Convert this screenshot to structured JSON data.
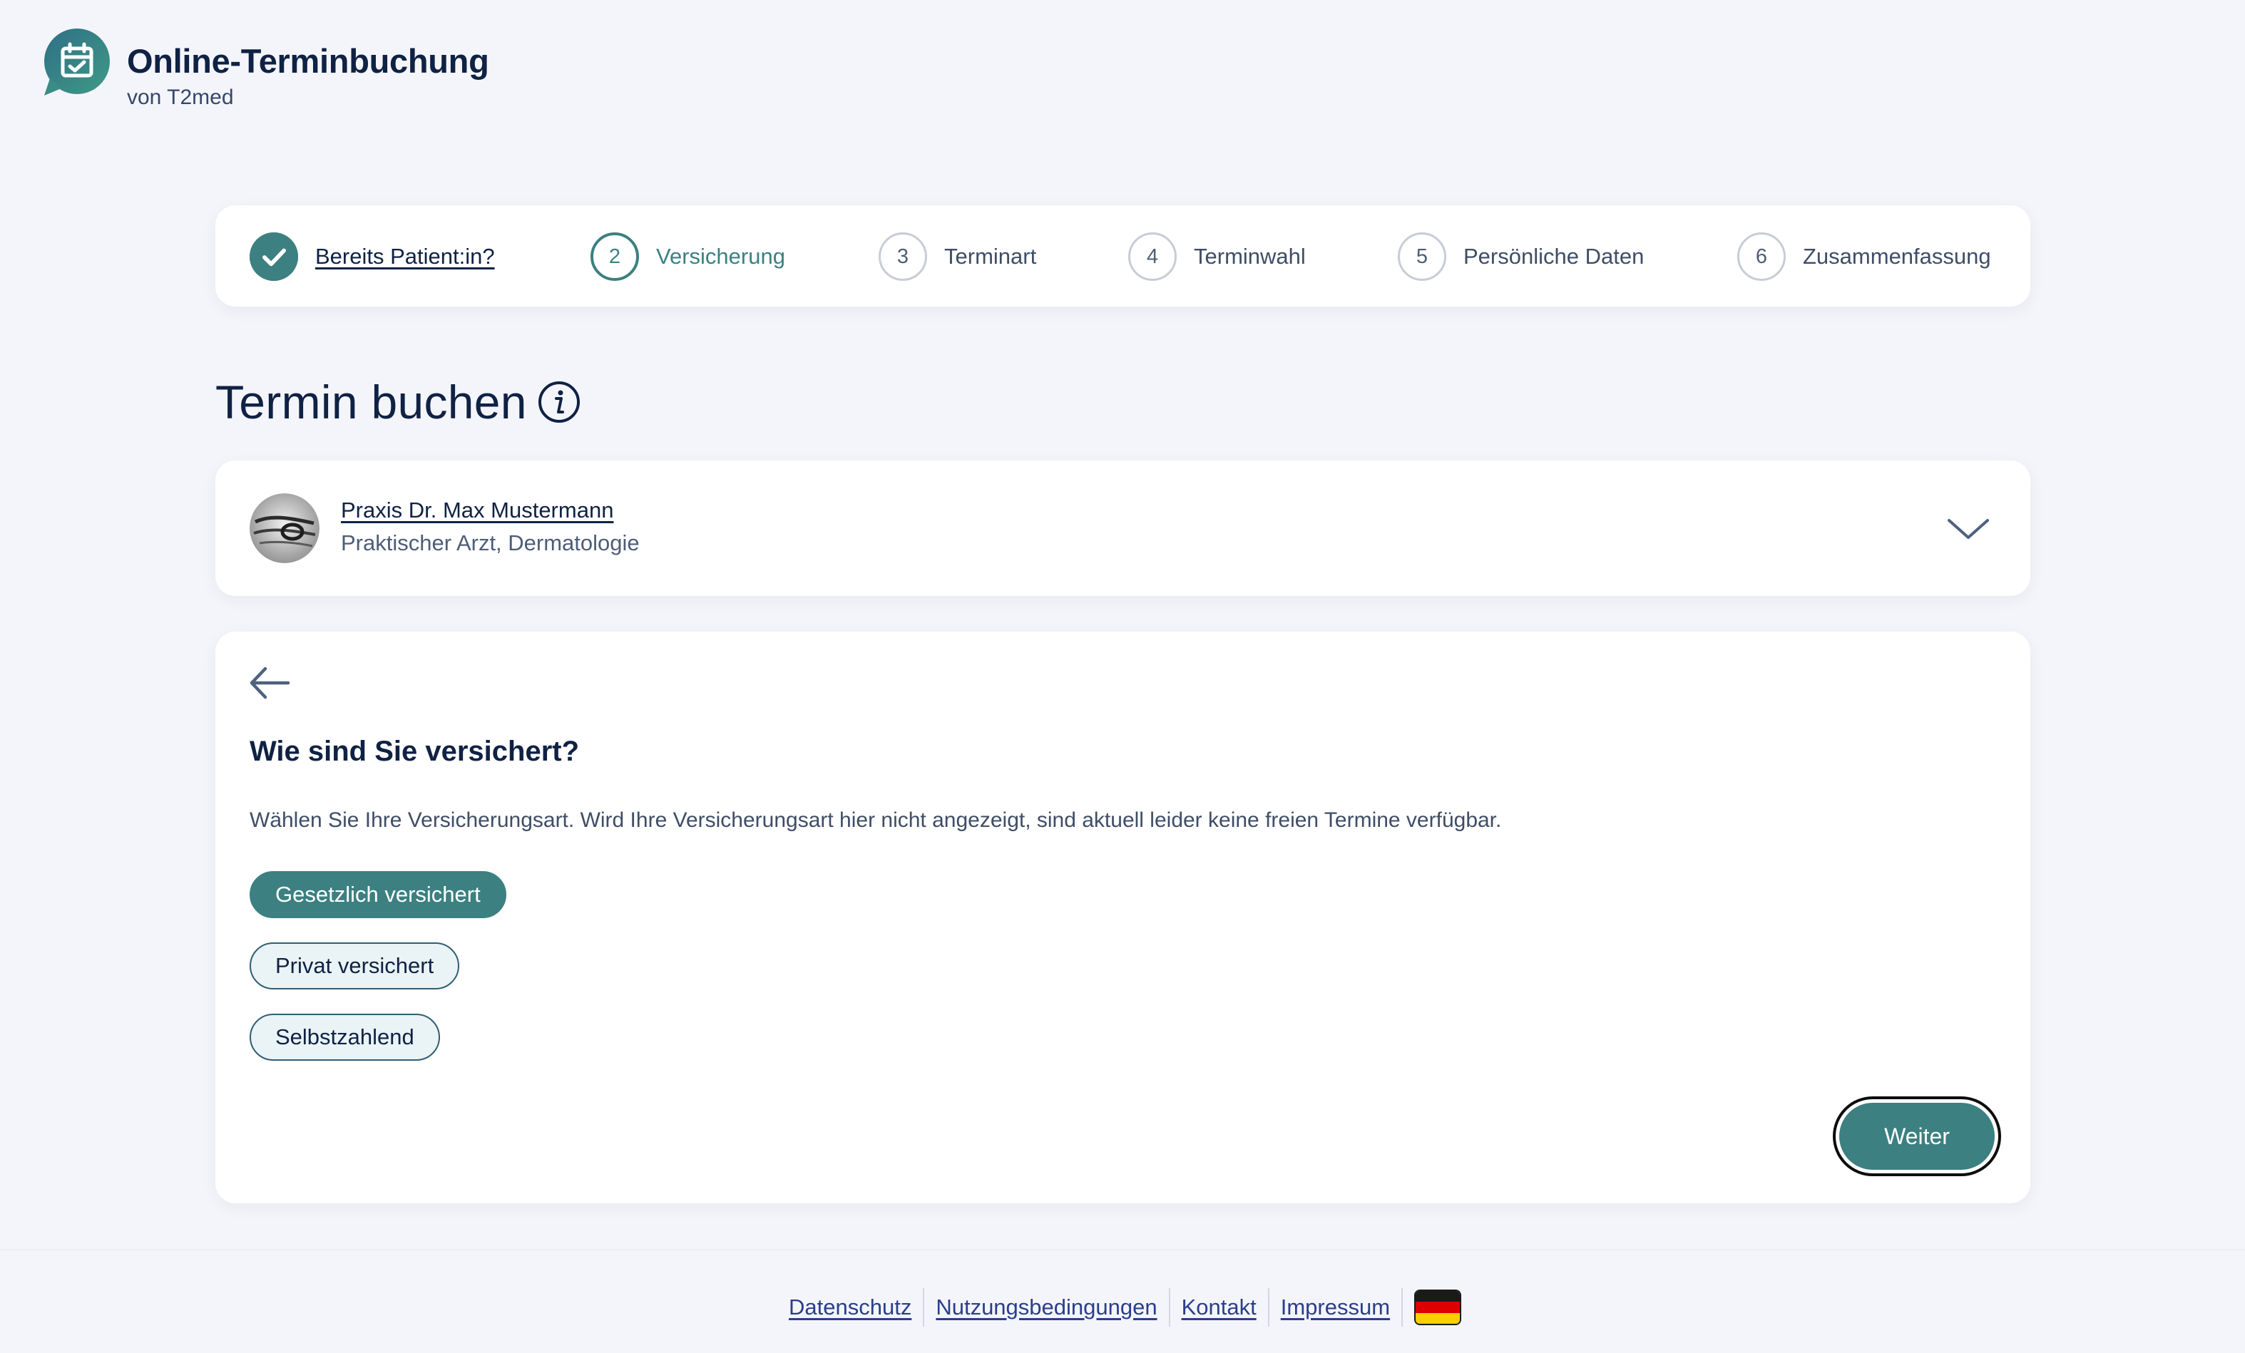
{
  "brand": {
    "title": "Online-Terminbuchung",
    "subtitle": "von T2med"
  },
  "stepper": {
    "steps": [
      {
        "number": "",
        "label": "Bereits Patient:in?",
        "state": "done"
      },
      {
        "number": "2",
        "label": "Versicherung",
        "state": "active"
      },
      {
        "number": "3",
        "label": "Terminart",
        "state": "upcoming"
      },
      {
        "number": "4",
        "label": "Terminwahl",
        "state": "upcoming"
      },
      {
        "number": "5",
        "label": "Persönliche Daten",
        "state": "upcoming"
      },
      {
        "number": "6",
        "label": "Zusammenfassung",
        "state": "upcoming"
      }
    ]
  },
  "main": {
    "title": "Termin buchen"
  },
  "practice": {
    "name": "Praxis Dr. Max Mustermann",
    "specialty": "Praktischer Arzt, Dermatologie"
  },
  "insurance": {
    "question": "Wie sind Sie versichert?",
    "description": "Wählen Sie Ihre Versicherungsart. Wird Ihre Versicherungsart hier nicht angezeigt, sind aktuell leider keine freien Termine verfügbar.",
    "options": [
      {
        "label": "Gesetzlich versichert",
        "selected": true
      },
      {
        "label": "Privat versichert",
        "selected": false
      },
      {
        "label": "Selbstzahlend",
        "selected": false
      }
    ],
    "next_label": "Weiter"
  },
  "footer": {
    "links": [
      "Datenschutz",
      "Nutzungsbedingungen",
      "Kontakt",
      "Impressum"
    ],
    "language_flag": "de-flag-icon"
  },
  "colors": {
    "accent": "#3c8081",
    "text_dark": "#0f2244",
    "background": "#f4f5fa",
    "link": "#2a3e8e"
  }
}
